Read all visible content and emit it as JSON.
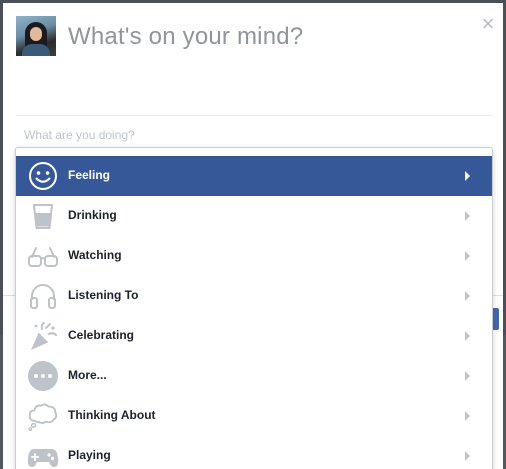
{
  "composer": {
    "prompt": "What's on your mind?",
    "activity_placeholder": "What are you doing?",
    "close_glyph": "×"
  },
  "activities": [
    {
      "label": "Feeling",
      "icon": "smiley-icon",
      "selected": true
    },
    {
      "label": "Drinking",
      "icon": "cup-icon",
      "selected": false
    },
    {
      "label": "Watching",
      "icon": "glasses-icon",
      "selected": false
    },
    {
      "label": "Listening To",
      "icon": "headphones-icon",
      "selected": false
    },
    {
      "label": "Celebrating",
      "icon": "party-popper-icon",
      "selected": false
    },
    {
      "label": "More...",
      "icon": "more-dots-icon",
      "selected": false
    },
    {
      "label": "Thinking About",
      "icon": "thought-cloud-icon",
      "selected": false
    },
    {
      "label": "Playing",
      "icon": "game-controller-icon",
      "selected": false
    }
  ],
  "colors": {
    "selected_bg": "#365899",
    "icon_gray": "#bec2c9",
    "label_dark": "#1d2129",
    "prompt_gray": "#90949c"
  }
}
